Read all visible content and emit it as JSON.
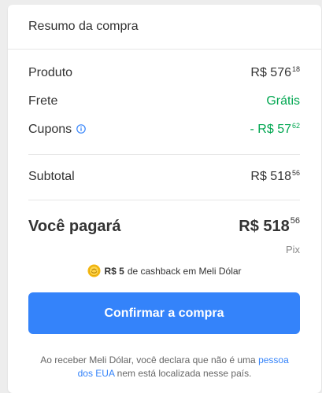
{
  "header": {
    "title": "Resumo da compra"
  },
  "summary": {
    "product": {
      "label": "Produto",
      "amount": "R$ 576",
      "cents": "18"
    },
    "shipping": {
      "label": "Frete",
      "value": "Grátis"
    },
    "coupons": {
      "label": "Cupons",
      "icon": "info-icon",
      "amount": "- R$ 57",
      "cents": "62"
    },
    "subtotal": {
      "label": "Subtotal",
      "amount": "R$ 518",
      "cents": "56"
    }
  },
  "total": {
    "label": "Você pagará",
    "amount": "R$ 518",
    "cents": "56",
    "method": "Pix"
  },
  "cashback": {
    "icon": "meli-dolar-coin-icon",
    "amount": "R$ 5",
    "text": "de cashback em Meli Dólar"
  },
  "confirm_button": {
    "label": "Confirmar a compra"
  },
  "disclaimer": {
    "before": "Ao receber Meli Dólar, você declara que não é uma",
    "link": "pessoa dos EUA",
    "after": "nem está localizada nesse país."
  },
  "colors": {
    "accent": "#3483fa",
    "positive": "#00a650",
    "coin": "#f5c518"
  }
}
